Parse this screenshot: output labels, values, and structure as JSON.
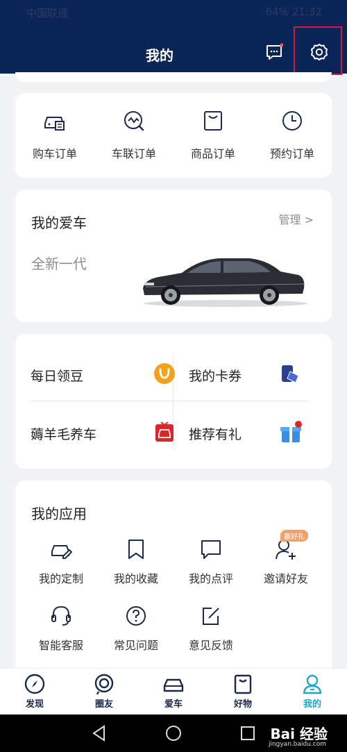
{
  "status_bar": {
    "carrier": "中国联通",
    "battery": "64%",
    "time": "21:32"
  },
  "header": {
    "title": "我的"
  },
  "orders": [
    {
      "icon": "car-order-icon",
      "label": "购车订单"
    },
    {
      "icon": "connected-order-icon",
      "label": "车联订单"
    },
    {
      "icon": "goods-order-icon",
      "label": "商品订单"
    },
    {
      "icon": "appointment-order-icon",
      "label": "预约订单"
    }
  ],
  "my_car": {
    "title": "我的爱车",
    "manage": "管理 >",
    "model": "全新一代"
  },
  "benefits": [
    {
      "label": "每日领豆",
      "icon": "bean-icon"
    },
    {
      "label": "我的卡券",
      "icon": "coupon-icon"
    },
    {
      "label": "薅羊毛养车",
      "icon": "gift-car-icon"
    },
    {
      "label": "推荐有礼",
      "icon": "gift-box-icon"
    }
  ],
  "apps": {
    "title": "我的应用",
    "badge": "赢好礼",
    "items": [
      {
        "label": "我的定制",
        "icon": "customize-icon"
      },
      {
        "label": "我的收藏",
        "icon": "bookmark-icon"
      },
      {
        "label": "我的点评",
        "icon": "comment-icon"
      },
      {
        "label": "邀请好友",
        "icon": "invite-friend-icon"
      },
      {
        "label": "智能客服",
        "icon": "headset-icon"
      },
      {
        "label": "常见问题",
        "icon": "faq-icon"
      },
      {
        "label": "意见反馈",
        "icon": "feedback-icon"
      }
    ]
  },
  "bottom_nav": [
    {
      "label": "发现",
      "icon": "compass-icon"
    },
    {
      "label": "圈友",
      "icon": "circle-icon"
    },
    {
      "label": "爱车",
      "icon": "car-icon"
    },
    {
      "label": "好物",
      "icon": "shop-icon"
    },
    {
      "label": "我的",
      "icon": "user-icon",
      "active": true
    }
  ],
  "watermark": {
    "text": "Bai 经验",
    "sub": "jingyan.baidu.com"
  },
  "colors": {
    "header_bg": "#0b2558",
    "accent": "#20a6c9",
    "highlight": "#d21f2b",
    "icon": "#1b2a4a"
  }
}
